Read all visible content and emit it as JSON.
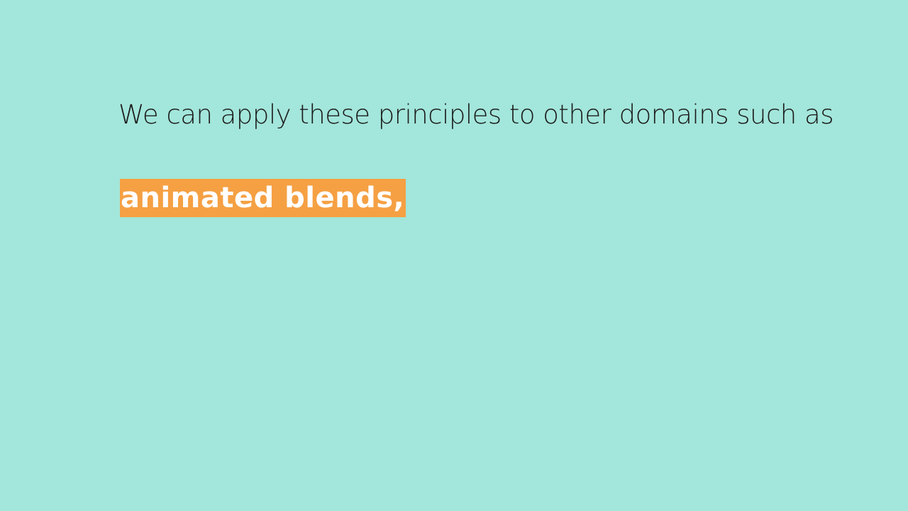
{
  "slide": {
    "intro_text": "We can apply these principles to other domains such as",
    "highlight_text": "animated blends,"
  },
  "colors": {
    "background": "#a3e6db",
    "text": "#1c1c1c",
    "highlight_background": "#f5a043",
    "highlight_text": "#ffffff"
  }
}
